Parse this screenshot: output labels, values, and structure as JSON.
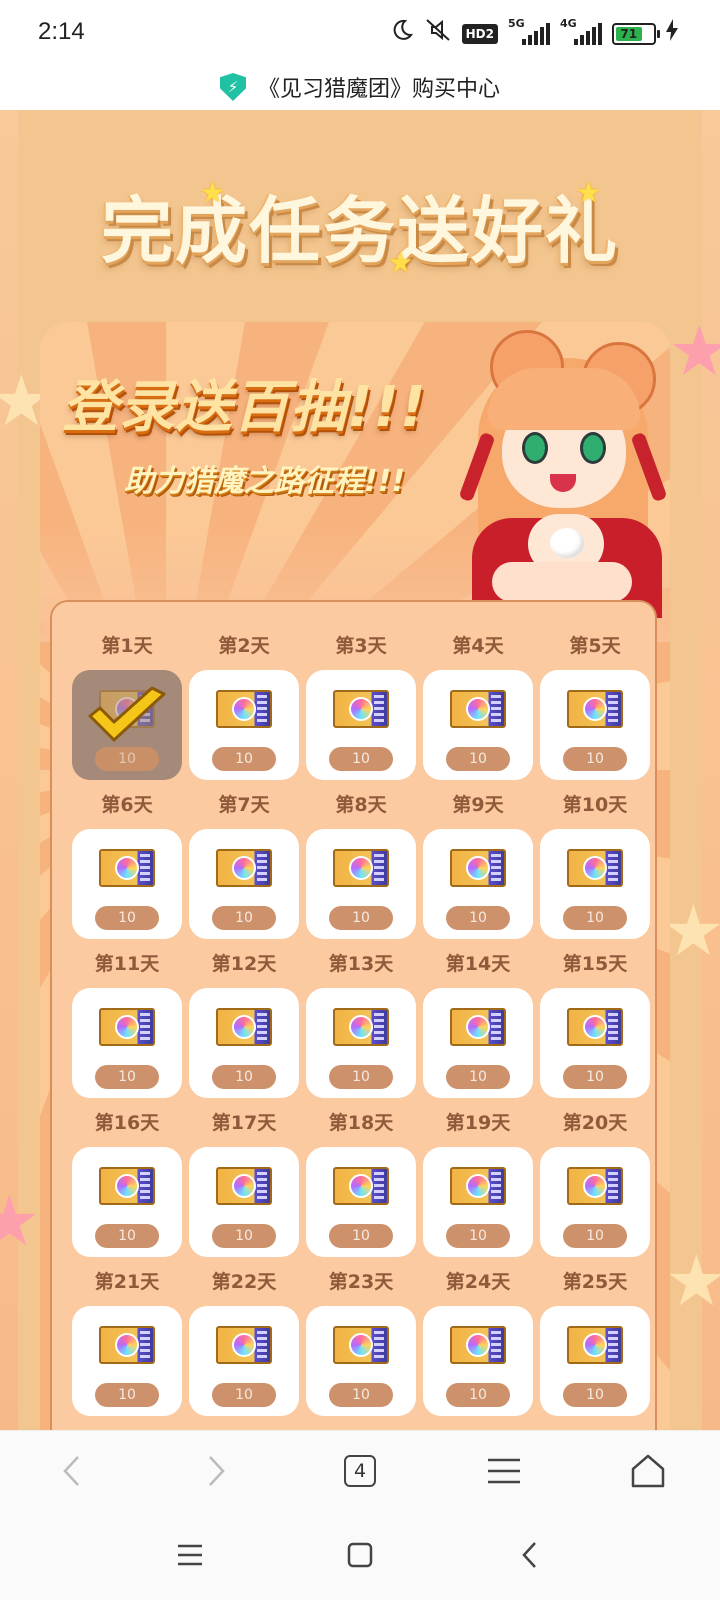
{
  "status_bar": {
    "time": "2:14",
    "hd_badge": "HD2",
    "network_1": "5G",
    "network_2": "4G",
    "battery": "71"
  },
  "title_bar": {
    "title": "《见习猎魔团》购买中心"
  },
  "page": {
    "headline": "完成任务送好礼",
    "banner_main": "登录送百抽!!!",
    "banner_sub": "助力猎魔之路征程!!!"
  },
  "rewards": [
    {
      "day": "第1天",
      "count": "10",
      "claimed": true
    },
    {
      "day": "第2天",
      "count": "10",
      "claimed": false
    },
    {
      "day": "第3天",
      "count": "10",
      "claimed": false
    },
    {
      "day": "第4天",
      "count": "10",
      "claimed": false
    },
    {
      "day": "第5天",
      "count": "10",
      "claimed": false
    },
    {
      "day": "第6天",
      "count": "10",
      "claimed": false
    },
    {
      "day": "第7天",
      "count": "10",
      "claimed": false
    },
    {
      "day": "第8天",
      "count": "10",
      "claimed": false
    },
    {
      "day": "第9天",
      "count": "10",
      "claimed": false
    },
    {
      "day": "第10天",
      "count": "10",
      "claimed": false
    },
    {
      "day": "第11天",
      "count": "10",
      "claimed": false
    },
    {
      "day": "第12天",
      "count": "10",
      "claimed": false
    },
    {
      "day": "第13天",
      "count": "10",
      "claimed": false
    },
    {
      "day": "第14天",
      "count": "10",
      "claimed": false
    },
    {
      "day": "第15天",
      "count": "10",
      "claimed": false
    },
    {
      "day": "第16天",
      "count": "10",
      "claimed": false
    },
    {
      "day": "第17天",
      "count": "10",
      "claimed": false
    },
    {
      "day": "第18天",
      "count": "10",
      "claimed": false
    },
    {
      "day": "第19天",
      "count": "10",
      "claimed": false
    },
    {
      "day": "第20天",
      "count": "10",
      "claimed": false
    },
    {
      "day": "第21天",
      "count": "10",
      "claimed": false
    },
    {
      "day": "第22天",
      "count": "10",
      "claimed": false
    },
    {
      "day": "第23天",
      "count": "10",
      "claimed": false
    },
    {
      "day": "第24天",
      "count": "10",
      "claimed": false
    },
    {
      "day": "第25天",
      "count": "10",
      "claimed": false
    }
  ],
  "browser_nav": {
    "tab_count": "4"
  },
  "icons": {
    "status": [
      "moon-icon",
      "mute-icon",
      "signal-icon",
      "battery-icon",
      "charging-icon"
    ],
    "title": "shield-icon",
    "reward": "draw-ticket-icon",
    "claimed": "checkmark-icon",
    "browser": [
      "back-arrow-icon",
      "forward-arrow-icon",
      "tabs-icon",
      "menu-icon",
      "home-icon"
    ],
    "system": [
      "recents-icon",
      "home-square-icon",
      "back-icon"
    ]
  },
  "colors": {
    "accent": "#21c1a4",
    "background": "#f9c08e",
    "tile": "#ffffff",
    "count_pill": "#cd926c",
    "day_text": "#8f5a3a"
  }
}
